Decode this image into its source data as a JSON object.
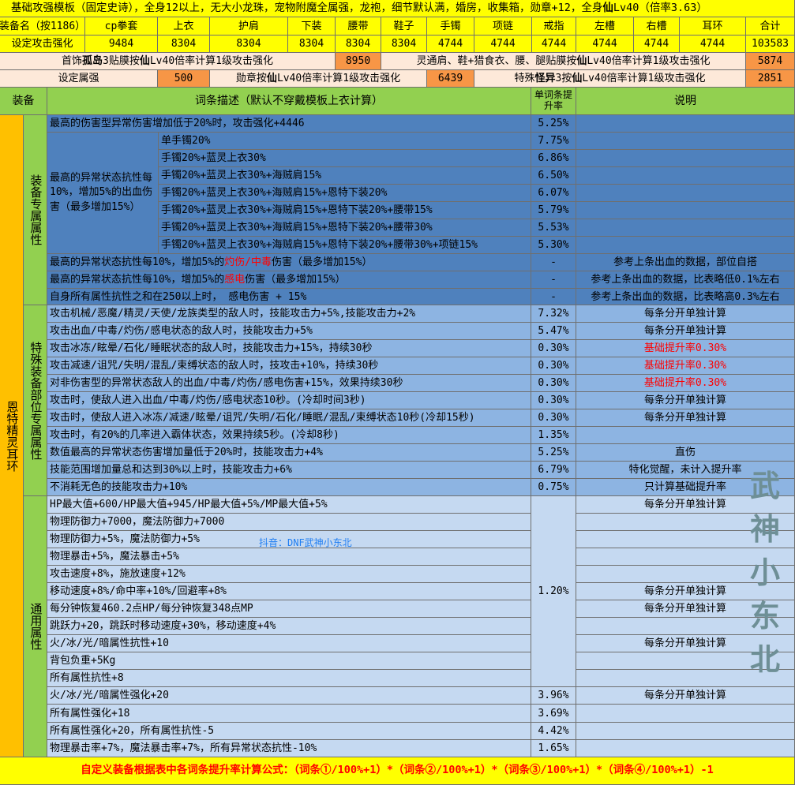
{
  "header": {
    "title_pre": "基础攻强模板（固定史诗），全身12以上，无大小龙珠，宠物附魔全属强，龙袍，细节默认满，婚房，收集箱，勋章+12，全身",
    "title_x": "仙",
    "title_post": "Lv40（倍率3.63）"
  },
  "slot_row": {
    "label": "装备名（按1186）",
    "slots": [
      "cp拳套",
      "上衣",
      "护肩",
      "下装",
      "腰带",
      "鞋子",
      "手镯",
      "项链",
      "戒指",
      "左槽",
      "右槽",
      "耳环"
    ],
    "total_label": "合计"
  },
  "attack_row": {
    "label": "设定攻击强化",
    "values": [
      "9484",
      "8304",
      "8304",
      "8304",
      "8304",
      "8304",
      "4744",
      "4744",
      "4744",
      "4744",
      "4744",
      "4744"
    ],
    "total": "103583"
  },
  "line2": {
    "left_pre": "首饰",
    "left_b1": "孤岛",
    "left_mid": "3贴膜按",
    "left_b2": "仙",
    "left_post": "Lv40倍率计算1级攻击强化",
    "left_value": "8950",
    "right_pre": "灵通肩、鞋+猎食衣、腰、腿贴膜按",
    "right_b": "仙",
    "right_post": "Lv40倍率计算1级攻击强化",
    "right_value": "5874"
  },
  "line3": {
    "label": "设定属强",
    "value1": "500",
    "medal_pre": "勋章按",
    "medal_b": "仙",
    "medal_post": "Lv40倍率计算1级攻击强化",
    "value2": "6439",
    "special_pre": "特殊",
    "special_b1": "怪异",
    "special_mid": "3按",
    "special_b2": "仙",
    "special_post": "Lv40倍率计算1级攻击强化",
    "value3": "2851"
  },
  "table_header": {
    "equip": "装备",
    "desc": "词条描述（默认不穿戴模板上衣计算）",
    "rate": "单词条提升率",
    "note": "说明"
  },
  "equip_name": "恩特精灵耳环",
  "groups": {
    "g1": "装备专属属性",
    "g2": "特殊装备部位专属属性",
    "g3": "通用属性"
  },
  "g1": {
    "r1": {
      "desc": "最高的伤害型异常伤害增加低于20%时，攻击强化+4446",
      "rate": "5.25%"
    },
    "bleed_label": "最高的异常状态抗性每10%，增加5%的出血伤害（最多增加15%）",
    "bleed": [
      {
        "cond": "单手镯20%",
        "rate": "7.75%"
      },
      {
        "cond": "手镯20%+蓝灵上衣30%",
        "rate": "6.86%"
      },
      {
        "cond": "手镯20%+蓝灵上衣30%+海贼肩15%",
        "rate": "6.50%"
      },
      {
        "cond": "手镯20%+蓝灵上衣30%+海贼肩15%+恩特下装20%",
        "rate": "6.07%"
      },
      {
        "cond": "手镯20%+蓝灵上衣30%+海贼肩15%+恩特下装20%+腰带15%",
        "rate": "5.79%"
      },
      {
        "cond": "手镯20%+蓝灵上衣30%+海贼肩15%+恩特下装20%+腰带30%",
        "rate": "5.53%"
      },
      {
        "cond": "手镯20%+蓝灵上衣30%+海贼肩15%+恩特下装20%+腰带30%+项链15%",
        "rate": "5.30%"
      }
    ],
    "r9": {
      "pre": "最高的异常状态抗性每10%，增加5%的",
      "red": "灼伤/中毒",
      "post": "伤害（最多增加15%）",
      "rate": "-",
      "note": "参考上条出血的数据，部位自搭"
    },
    "r10": {
      "pre": "最高的异常状态抗性每10%，增加5%的",
      "red": "感电",
      "post": "伤害（最多增加15%）",
      "rate": "-",
      "note": "参考上条出血的数据，比表略低0.1%左右"
    },
    "r11": {
      "desc": "自身所有属性抗性之和在250以上时， 感电伤害 + 15%",
      "rate": "-",
      "note": "参考上条出血的数据，比表略高0.3%左右"
    }
  },
  "g2": [
    {
      "desc": "攻击机械/恶魔/精灵/天使/龙族类型的敌人时，技能攻击力+5%,技能攻击力+2%",
      "rate": "7.32%",
      "note": "每条分开单独计算",
      "red": false
    },
    {
      "desc": "攻击出血/中毒/灼伤/感电状态的敌人时，技能攻击力+5%",
      "rate": "5.47%",
      "note": "每条分开单独计算",
      "red": false
    },
    {
      "desc": "攻击冰冻/眩晕/石化/睡眠状态的敌人时，技能攻击力+15%，持续30秒",
      "rate": "0.30%",
      "note": "基础提升率0.30%",
      "red": true
    },
    {
      "desc": "攻击减速/诅咒/失明/混乱/束缚状态的敌人时，技攻击+10%，持续30秒",
      "rate": "0.30%",
      "note": "基础提升率0.30%",
      "red": true
    },
    {
      "desc": "对非伤害型的异常状态敌人的出血/中毒/灼伤/感电伤害+15%，效果持续30秒",
      "rate": "0.30%",
      "note": "基础提升率0.30%",
      "red": true
    },
    {
      "desc": "攻击时，使敌人进入出血/中毒/灼伤/感电状态10秒。(冷却时间3秒)",
      "rate": "0.30%",
      "note": "每条分开单独计算",
      "red": false
    },
    {
      "desc": "攻击时，使敌人进入冰冻/减速/眩晕/诅咒/失明/石化/睡眠/混乱/束缚状态10秒(冷却15秒)",
      "rate": "0.30%",
      "note": "每条分开单独计算",
      "red": false
    },
    {
      "desc": "攻击时，有20%的几率进入霸体状态，效果持续5秒。(冷却8秒)",
      "rate": "1.35%",
      "note": "",
      "red": false
    },
    {
      "desc": "数值最高的异常状态伤害增加量低于20%时，技能攻击力+4%",
      "rate": "5.25%",
      "note": "直伤",
      "red": false
    },
    {
      "desc": "技能范围增加量总和达到30%以上时，技能攻击力+6%",
      "rate": "6.79%",
      "note": "特化觉醒，未计入提升率",
      "red": false
    },
    {
      "desc": "不消耗无色的技能攻击力+10%",
      "rate": "0.75%",
      "note": "只计算基础提升率",
      "red": false
    }
  ],
  "g3": {
    "merged_rate": "1.20%",
    "rows": [
      {
        "desc": "HP最大值+600/HP最大值+945/HP最大值+5%/MP最大值+5%",
        "note": "每条分开单独计算"
      },
      {
        "desc": "物理防御力+7000，魔法防御力+7000",
        "note": ""
      },
      {
        "desc": "物理防御力+5%，魔法防御力+5%",
        "note": ""
      },
      {
        "desc": "物理暴击+5%，魔法暴击+5%",
        "note": ""
      },
      {
        "desc": "攻击速度+8%，施放速度+12%",
        "note": ""
      },
      {
        "desc": "移动速度+8%/命中率+10%/回避率+8%",
        "note": "每条分开单独计算"
      },
      {
        "desc": "每分钟恢复460.2点HP/每分钟恢复348点MP",
        "note": "每条分开单独计算"
      },
      {
        "desc": "跳跃力+20，跳跃时移动速度+30%，移动速度+4%",
        "note": ""
      },
      {
        "desc": "火/冰/光/暗属性抗性+10",
        "note": "每条分开单独计算"
      },
      {
        "desc": "背包负重+5Kg",
        "note": ""
      },
      {
        "desc": "所有属性抗性+8",
        "note": ""
      }
    ],
    "tail": [
      {
        "desc": "火/冰/光/暗属性强化+20",
        "rate": "3.96%",
        "note": "每条分开单独计算"
      },
      {
        "desc": "所有属性强化+18",
        "rate": "3.69%",
        "note": ""
      },
      {
        "desc": "所有属性强化+20，所有属性抗性-5",
        "rate": "4.42%",
        "note": ""
      },
      {
        "desc": "物理暴击率+7%，魔法暴击率+7%，所有异常状态抗性-10%",
        "rate": "1.65%",
        "note": ""
      }
    ]
  },
  "watermark": {
    "chars": [
      "武",
      "神",
      "小",
      "东",
      "北"
    ],
    "douyin": "抖音：DNF武神小东北"
  },
  "footer": "自定义装备根据表中各词条提升率计算公式：（词条①/100%+1）*（词条②/100%+1）*（词条③/100%+1）*（词条④/100%+1）-1",
  "colors": {
    "yellow": "#ffff00",
    "green": "#92d050",
    "peach": "#fde9d9",
    "orange": "#f79646",
    "blue_dark": "#4f81bd",
    "blue_mid": "#8db4e2",
    "blue_light": "#c5d9f1",
    "gold": "#ffc000",
    "red_text": "#ff0000"
  }
}
